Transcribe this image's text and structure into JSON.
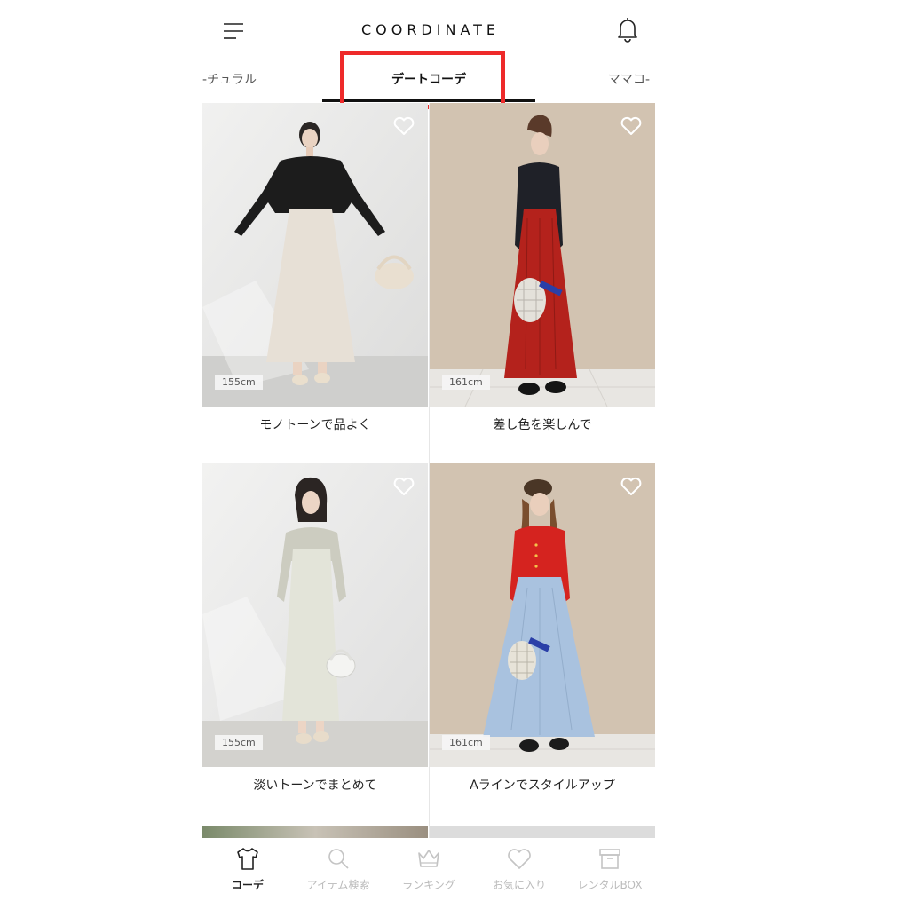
{
  "header": {
    "title": "COORDINATE",
    "menu_icon": "hamburger-menu-icon",
    "notification_icon": "bell-icon"
  },
  "tabs": {
    "left_partial": "-チュラル",
    "active": "デートコーデ",
    "right_partial": "ママコ-"
  },
  "highlight_color": "#ee2a2a",
  "cards": [
    {
      "caption": "モノトーンで品よく",
      "height": "155cm",
      "favorite_icon": "heart-outline-icon"
    },
    {
      "caption": "差し色を楽しんで",
      "height": "161cm",
      "favorite_icon": "heart-outline-icon"
    },
    {
      "caption": "淡いトーンでまとめて",
      "height": "155cm",
      "favorite_icon": "heart-outline-icon"
    },
    {
      "caption": "Aラインでスタイルアップ",
      "height": "161cm",
      "favorite_icon": "heart-outline-icon"
    }
  ],
  "bottom_nav": {
    "items": [
      {
        "label": "コーデ",
        "icon": "tshirt-icon",
        "active": true
      },
      {
        "label": "アイテム検索",
        "icon": "search-icon",
        "active": false
      },
      {
        "label": "ランキング",
        "icon": "crown-icon",
        "active": false
      },
      {
        "label": "お気に入り",
        "icon": "heart-icon",
        "active": false
      },
      {
        "label": "レンタルBOX",
        "icon": "box-icon",
        "active": false
      }
    ]
  }
}
